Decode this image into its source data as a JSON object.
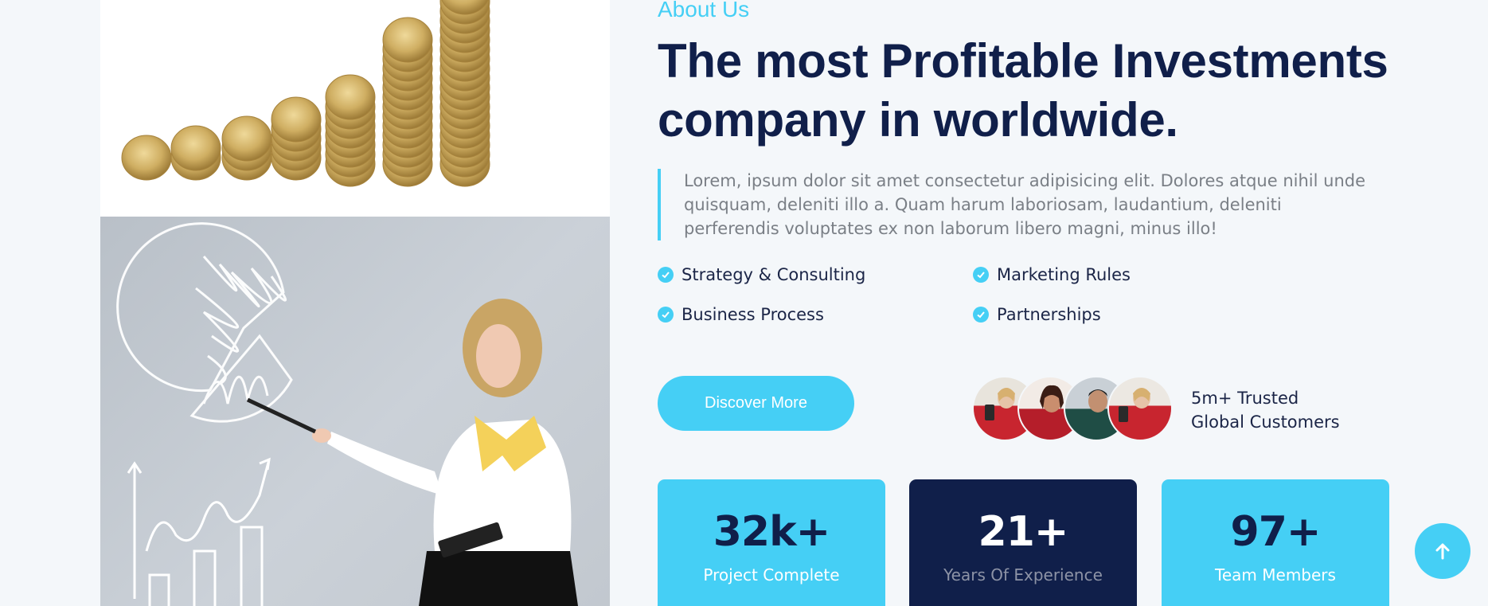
{
  "about": {
    "kicker": "About Us",
    "title_line1": "The most Profitable Investments",
    "title_line2": "company in worldwide.",
    "description": "Lorem, ipsum dolor sit amet consectetur adipisicing elit. Dolores atque nihil unde quisquam, deleniti illo a. Quam harum laboriosam, laudantium, deleniti perferendis voluptates ex non laborum libero magni, minus illo!"
  },
  "features": [
    {
      "label": "Strategy & Consulting",
      "icon": "check-circle-icon"
    },
    {
      "label": "Marketing Rules",
      "icon": "check-circle-icon"
    },
    {
      "label": "Business Process",
      "icon": "check-circle-icon"
    },
    {
      "label": "Partnerships",
      "icon": "check-circle-icon"
    }
  ],
  "cta": {
    "discover_label": "Discover More"
  },
  "customers": {
    "line1": "5m+ Trusted",
    "line2": "Global Customers"
  },
  "stats": [
    {
      "value": "32k+",
      "label": "Project Complete"
    },
    {
      "value": "21+",
      "label": "Years Of Experience"
    },
    {
      "value": "97+",
      "label": "Team Members"
    }
  ],
  "colors": {
    "accent": "#45cff5",
    "navy": "#101f4a",
    "background": "#f4f7fa"
  },
  "scroll_top": {
    "icon": "arrow-up-icon"
  }
}
